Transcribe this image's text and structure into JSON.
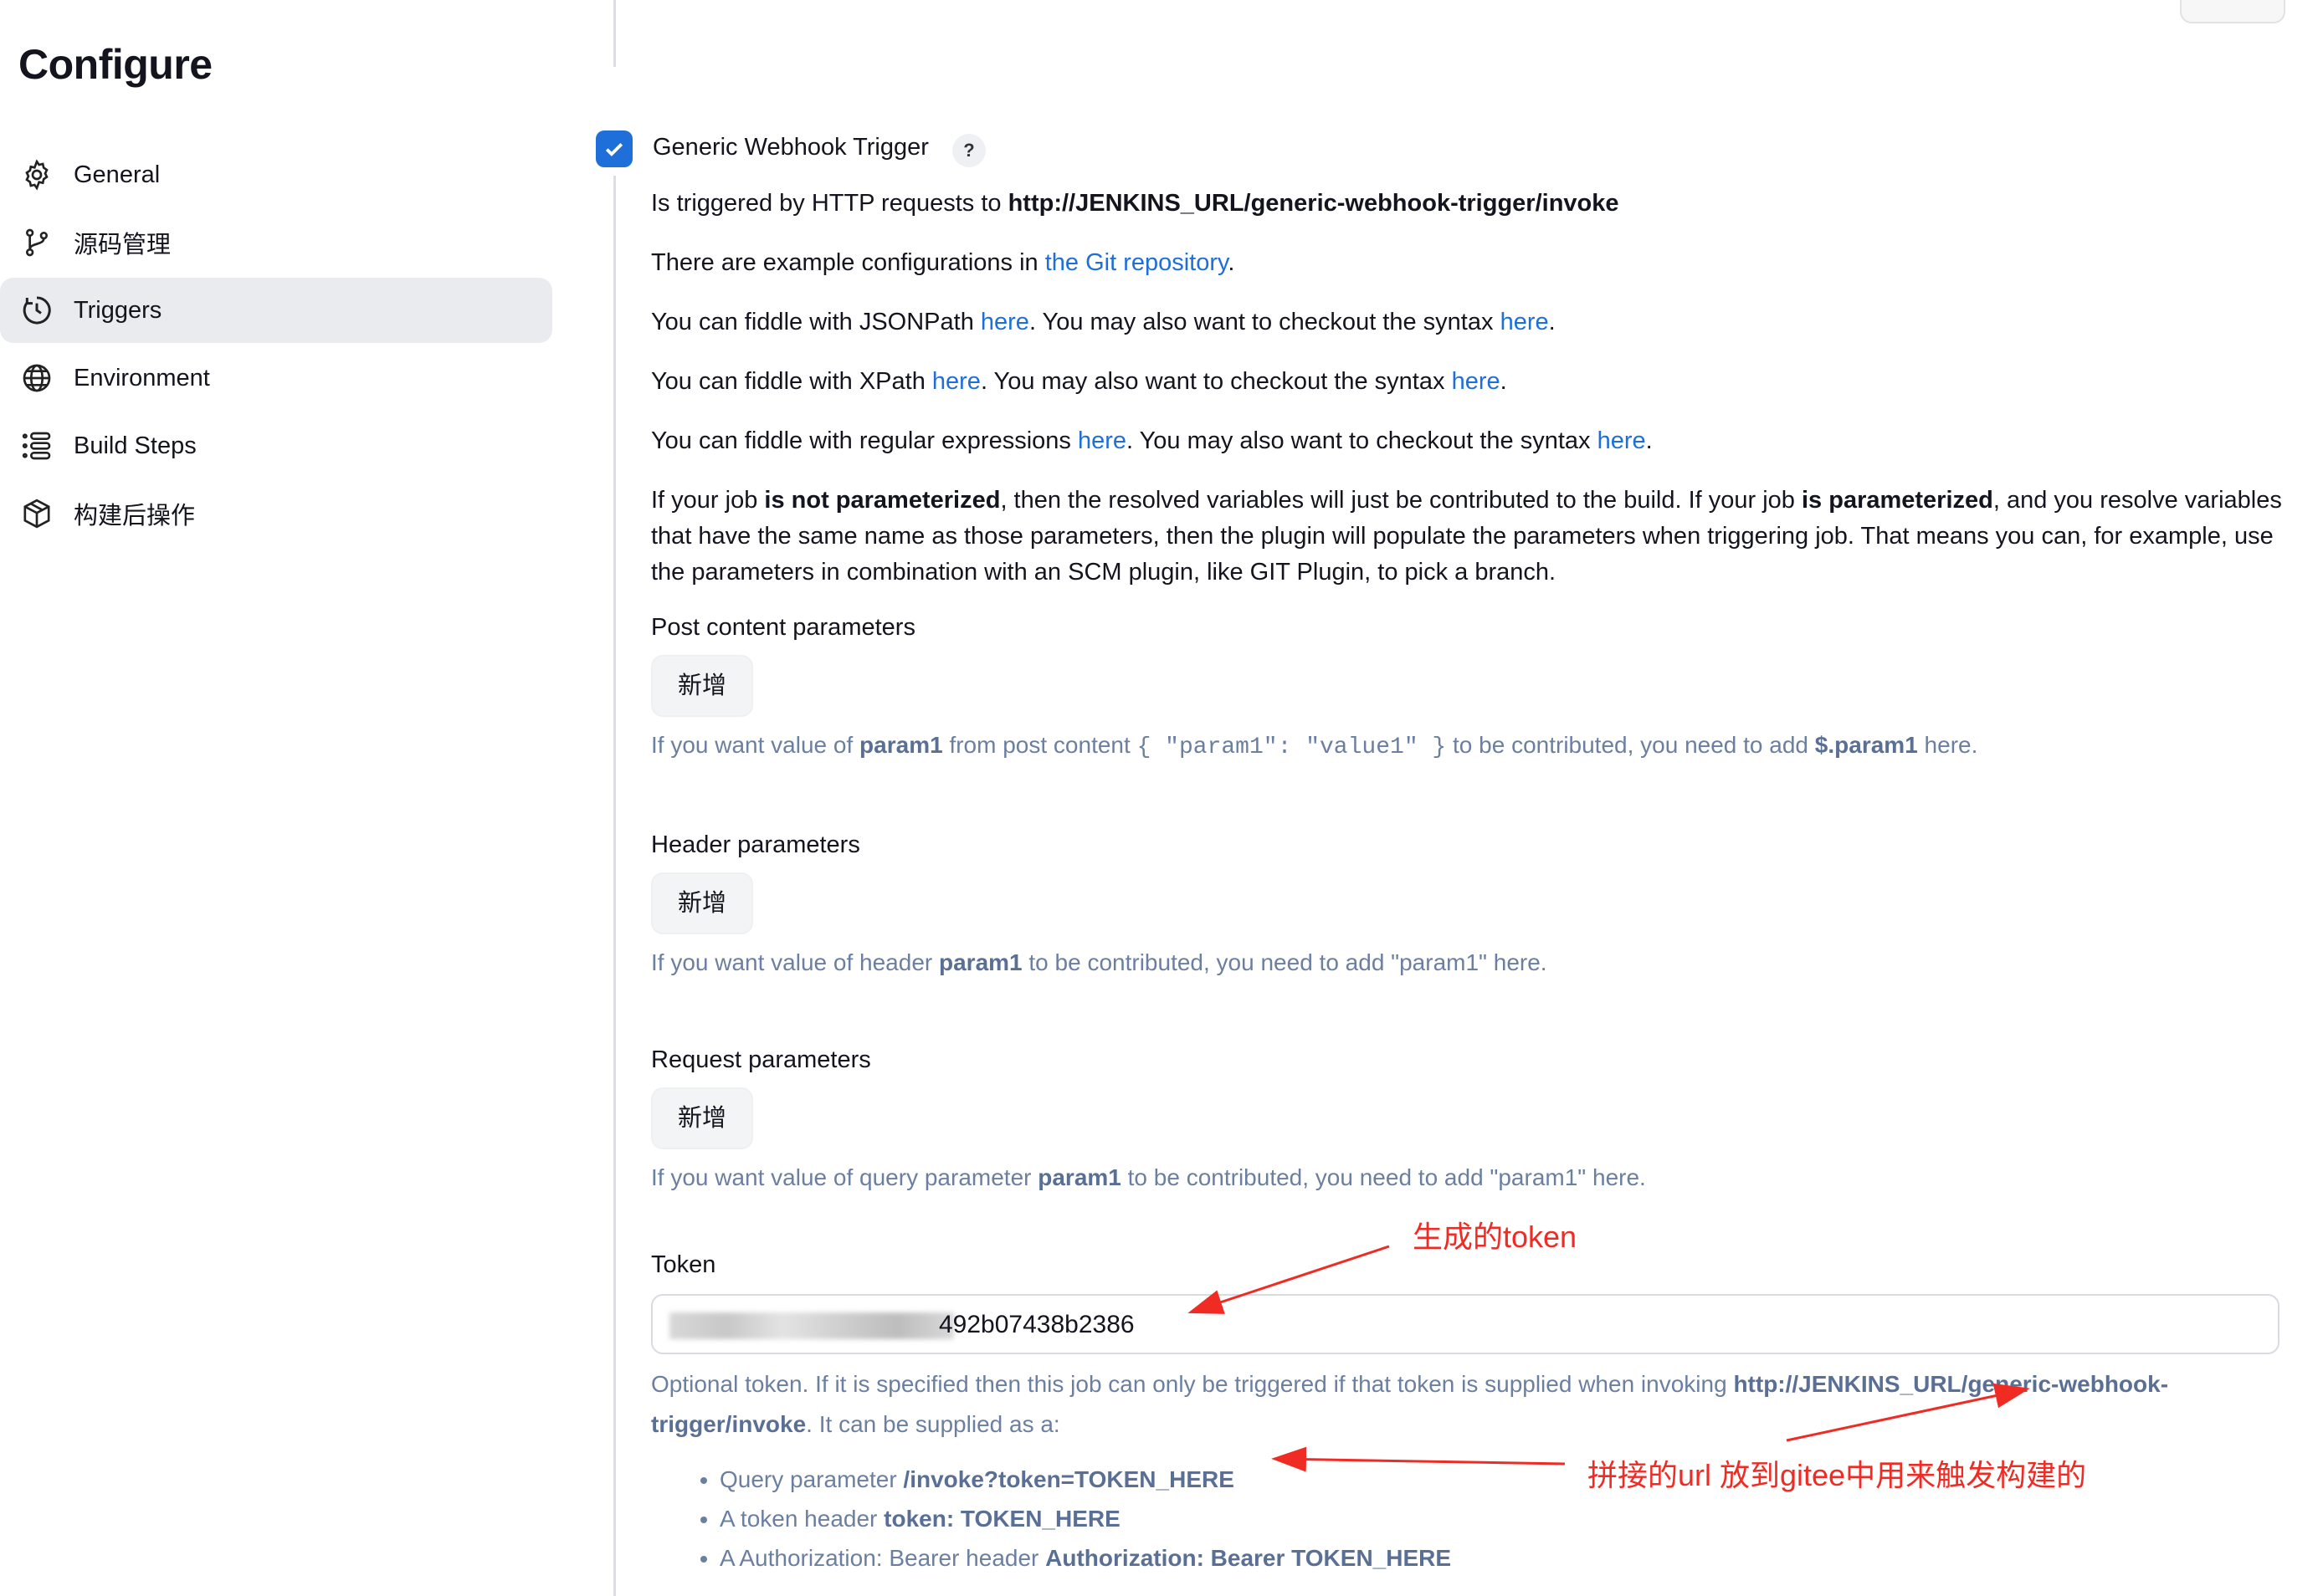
{
  "page": {
    "title": "Configure"
  },
  "sidebar": {
    "items": [
      {
        "label": "General",
        "icon": "gear-icon"
      },
      {
        "label": "源码管理",
        "icon": "branch-icon"
      },
      {
        "label": "Triggers",
        "icon": "clock-icon",
        "active": true
      },
      {
        "label": "Environment",
        "icon": "globe-icon"
      },
      {
        "label": "Build Steps",
        "icon": "list-icon"
      },
      {
        "label": "构建后操作",
        "icon": "package-icon"
      }
    ]
  },
  "trigger": {
    "title": "Generic Webhook Trigger",
    "help": "?",
    "checked": true
  },
  "description": {
    "p1_prefix": "Is triggered by HTTP requests to ",
    "p1_url": "http://JENKINS_URL/generic-webhook-trigger/invoke",
    "p2_prefix": "There are example configurations in ",
    "p2_link": "the Git repository",
    "p2_suffix": ".",
    "p3_prefix": "You can fiddle with JSONPath ",
    "p3_link1": "here",
    "p3_mid": ". You may also want to checkout the syntax ",
    "p3_link2": "here",
    "p3_suffix": ".",
    "p4_prefix": "You can fiddle with XPath ",
    "p4_link1": "here",
    "p4_mid": ". You may also want to checkout the syntax ",
    "p4_link2": "here",
    "p4_suffix": ".",
    "p5_prefix": "You can fiddle with regular expressions ",
    "p5_link1": "here",
    "p5_mid": ". You may also want to checkout the syntax ",
    "p5_link2": "here",
    "p5_suffix": ".",
    "p6_a": "If your job ",
    "p6_b": "is not parameterized",
    "p6_c": ", then the resolved variables will just be contributed to the build. If your job ",
    "p6_d": "is parameterized",
    "p6_e": ", and you resolve variables that have the same name as those parameters, then the plugin will populate the parameters when triggering job. That means you can, for example, use the parameters in combination with an SCM plugin, like GIT Plugin, to pick a branch."
  },
  "post_params": {
    "label": "Post content parameters",
    "add_label": "新增",
    "hint_a": "If you want value of ",
    "hint_b": "param1",
    "hint_c": " from post content ",
    "hint_code": "{ \"param1\": \"value1\" }",
    "hint_d": " to be contributed, you need to add ",
    "hint_e": "$.param1",
    "hint_f": " here."
  },
  "header_params": {
    "label": "Header parameters",
    "add_label": "新增",
    "hint_a": "If you want value of header ",
    "hint_b": "param1",
    "hint_c": " to be contributed, you need to add \"param1\" here."
  },
  "request_params": {
    "label": "Request parameters",
    "add_label": "新增",
    "hint_a": "If you want value of query parameter ",
    "hint_b": "param1",
    "hint_c": " to be contributed, you need to add \"param1\" here."
  },
  "token": {
    "label": "Token",
    "value_visible": "492b07438b2386",
    "hint_a": "Optional token. If it is specified then this job can only be triggered if that token is supplied when invoking ",
    "hint_url": "http://JENKINS_URL/generic-webhook-trigger/invoke",
    "hint_b": ". It can be supplied as a:",
    "list": [
      {
        "prefix": "Query parameter ",
        "bold": "/invoke?token=TOKEN_HERE"
      },
      {
        "prefix": "A token header ",
        "bold": "token: TOKEN_HERE"
      },
      {
        "prefix": "A Authorization: Bearer header ",
        "bold": "Authorization: Bearer TOKEN_HERE"
      }
    ]
  },
  "annotations": {
    "token_note": "生成的token",
    "url_note": "拼接的url 放到gitee中用来触发构建的",
    "color": "#ef2b24"
  }
}
